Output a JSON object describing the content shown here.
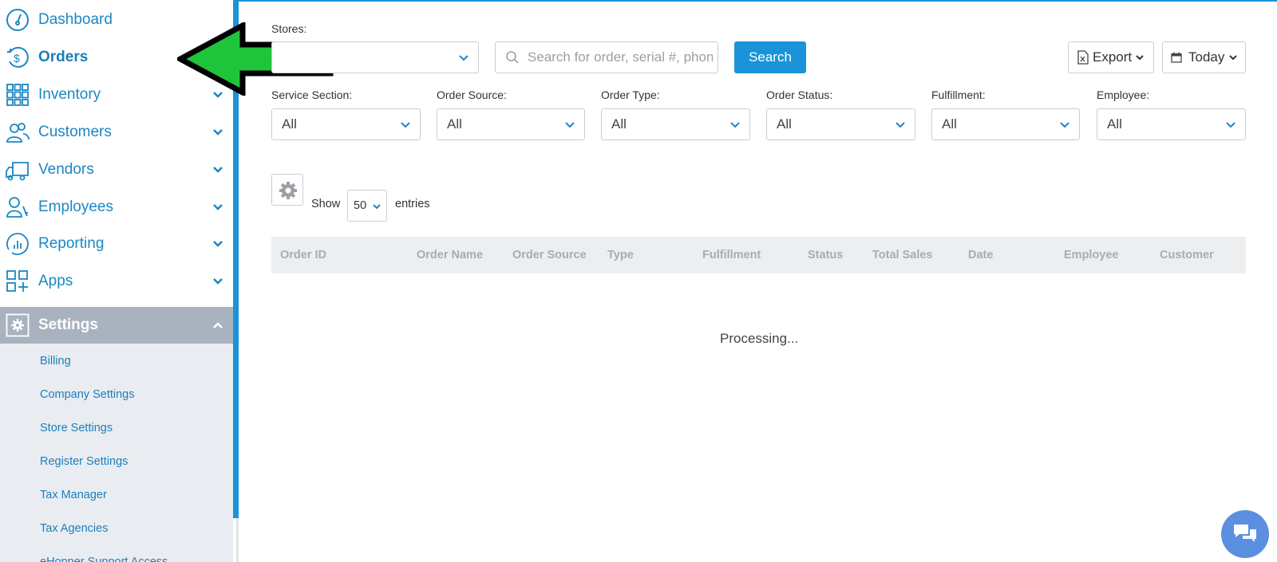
{
  "sidebar": {
    "items": [
      {
        "label": "Dashboard",
        "icon": "gauge-icon"
      },
      {
        "label": "Orders",
        "icon": "dollar-cycle-icon"
      },
      {
        "label": "Inventory",
        "icon": "grid-icon"
      },
      {
        "label": "Customers",
        "icon": "users-icon"
      },
      {
        "label": "Vendors",
        "icon": "truck-icon"
      },
      {
        "label": "Employees",
        "icon": "employee-icon"
      },
      {
        "label": "Reporting",
        "icon": "chart-icon"
      },
      {
        "label": "Apps",
        "icon": "apps-icon"
      },
      {
        "label": "Settings",
        "icon": "gear-icon"
      }
    ],
    "settings_sub": [
      "Billing",
      "Company Settings",
      "Store Settings",
      "Register Settings",
      "Tax Manager",
      "Tax Agencies",
      "eHopper Support Access"
    ]
  },
  "filters": {
    "stores_label": "Stores:",
    "stores_value": "",
    "search_placeholder": "Search for order, serial #, phone",
    "search_button": "Search",
    "export_label": "Export",
    "date_label": "Today",
    "selects": [
      {
        "label": "Service Section:",
        "value": "All"
      },
      {
        "label": "Order Source:",
        "value": "All"
      },
      {
        "label": "Order Type:",
        "value": "All"
      },
      {
        "label": "Order Status:",
        "value": "All"
      },
      {
        "label": "Fulfillment:",
        "value": "All"
      },
      {
        "label": "Employee:",
        "value": "All"
      }
    ]
  },
  "table": {
    "show_label": "Show",
    "entries_value": "50",
    "entries_label": "entries",
    "columns": [
      "Order ID",
      "Order Name",
      "Order Source",
      "Type",
      "Fulfillment",
      "Status",
      "Total Sales",
      "Date",
      "Employee",
      "Customer"
    ],
    "status_text": "Processing..."
  },
  "colors": {
    "accent": "#1a94d8",
    "link": "#1a87c5",
    "settings_bg": "#a9b3bf",
    "subnav_bg": "#e9edf1",
    "arrow_green": "#1fc43a"
  }
}
